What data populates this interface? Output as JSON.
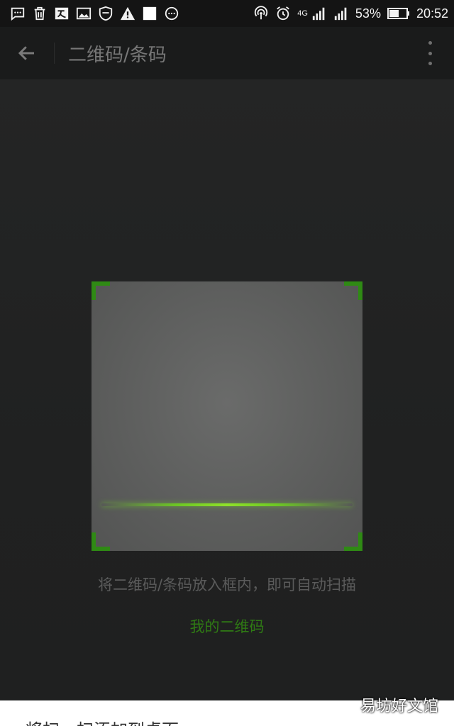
{
  "status_bar": {
    "left_icons": [
      "message-icon",
      "trash-icon",
      "translate-icon",
      "image-icon",
      "shield-icon",
      "warning-icon",
      "square-icon",
      "more-dots-icon"
    ],
    "network_label": "4G",
    "battery_percent": "53%",
    "time": "20:52"
  },
  "app_bar": {
    "title": "二维码/条码"
  },
  "scanner": {
    "hint": "将二维码/条码放入框内，即可自动扫描",
    "my_qr_link": "我的二维码",
    "accent_color": "#2f8a14"
  },
  "bottom_sheet": {
    "text": "将扫一扫添加到桌面"
  },
  "watermark": {
    "text": "易坊好文馆"
  }
}
